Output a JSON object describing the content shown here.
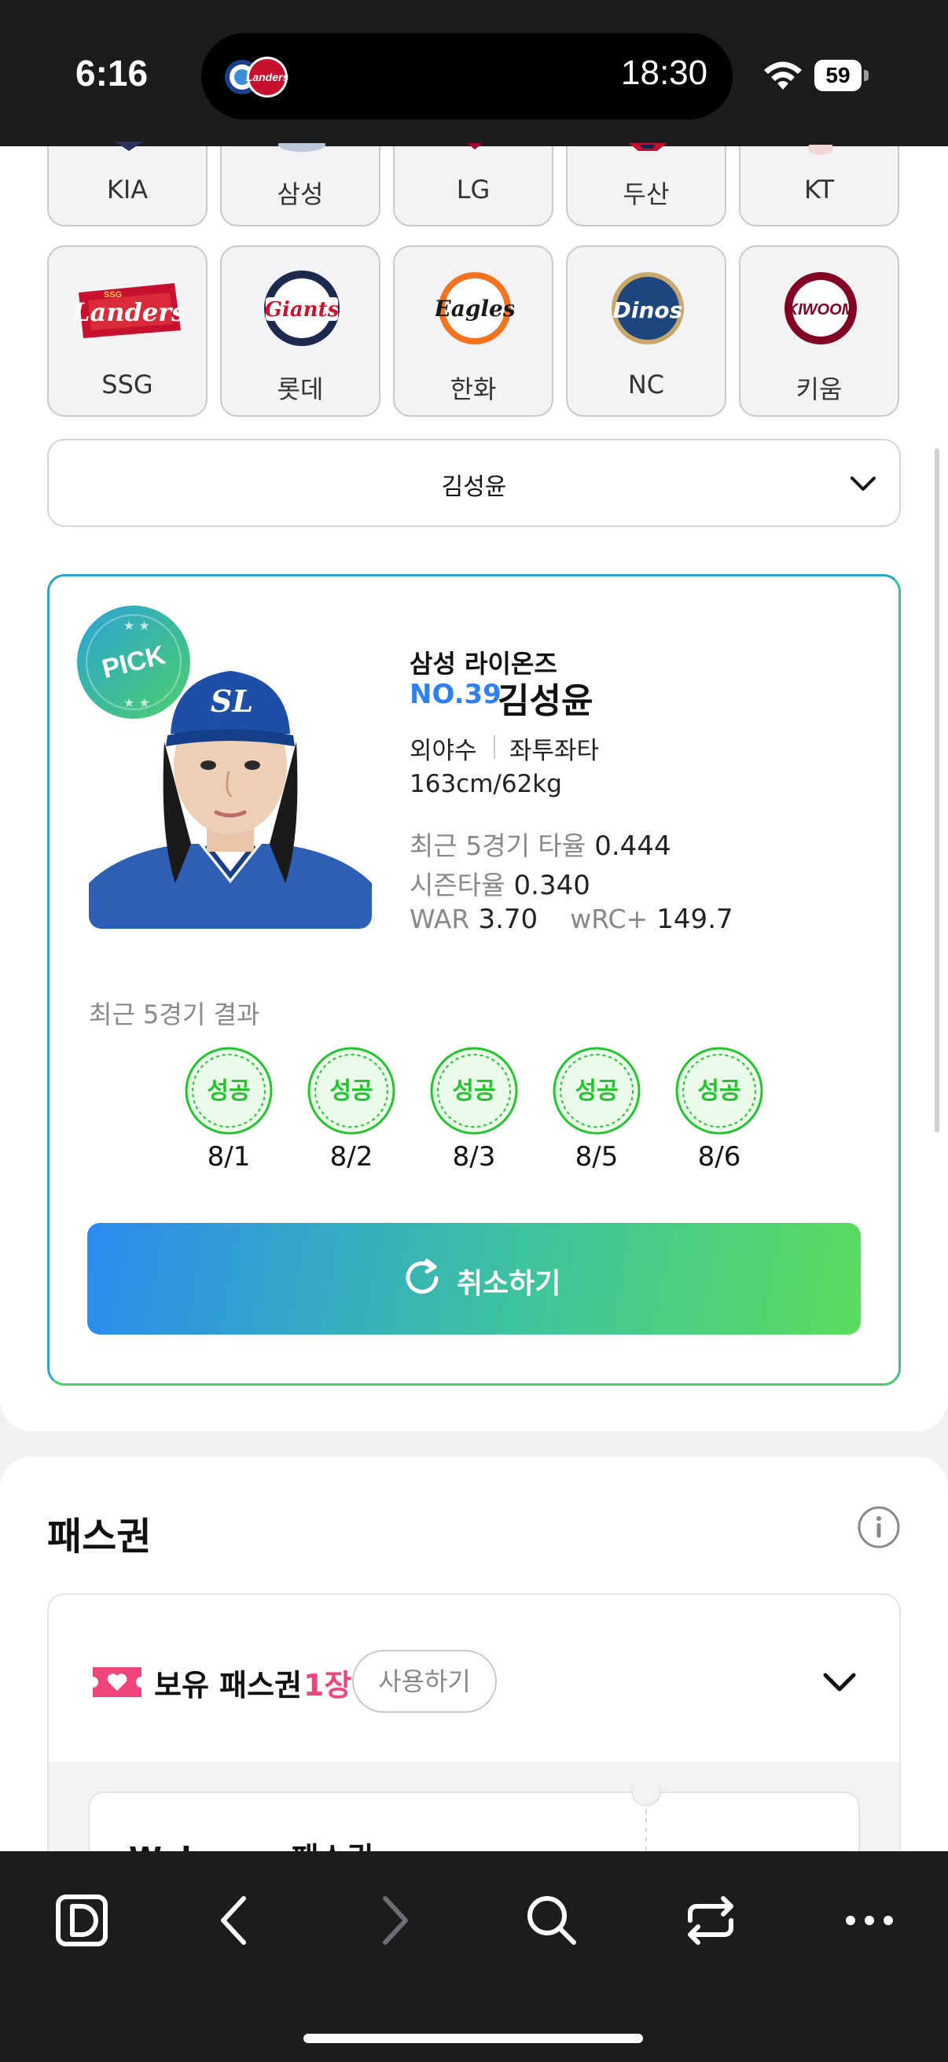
{
  "status_bar": {
    "time": "6:16",
    "island_time": "18:30",
    "battery": "59"
  },
  "teams": [
    {
      "name": "KIA",
      "icon": "kia-tigers-logo"
    },
    {
      "name": "삼성",
      "icon": "samsung-lions-logo"
    },
    {
      "name": "LG",
      "icon": "lg-twins-logo"
    },
    {
      "name": "두산",
      "icon": "doosan-bears-logo"
    },
    {
      "name": "KT",
      "icon": "kt-wiz-logo"
    },
    {
      "name": "SSG",
      "icon": "ssg-landers-logo"
    },
    {
      "name": "롯데",
      "icon": "lotte-giants-logo"
    },
    {
      "name": "한화",
      "icon": "hanwha-eagles-logo"
    },
    {
      "name": "NC",
      "icon": "nc-dinos-logo"
    },
    {
      "name": "키움",
      "icon": "kiwoom-heroes-logo"
    }
  ],
  "logo_text": {
    "ssg": "Landers",
    "lotte": "Giants",
    "hanwha": "Eagles",
    "nc": "Dinos",
    "kiwoom": "KIWOOM",
    "cap": "SL"
  },
  "player_select": {
    "value": "김성윤"
  },
  "player": {
    "badge": "PICK",
    "team": "삼성 라이온즈",
    "number": "NO.39",
    "name": "김성윤",
    "position": "외야수",
    "hand": "좌투좌타",
    "physical": "163cm/62kg",
    "stats": {
      "recent5_avg_label": "최근 5경기 타율",
      "recent5_avg": "0.444",
      "season_avg_label": "시즌타율",
      "season_avg": "0.340",
      "war_label": "WAR",
      "war": "3.70",
      "wrc_label": "wRC+",
      "wrc": "149.7"
    },
    "recent_label": "최근 5경기 결과",
    "results": [
      {
        "result": "성공",
        "date": "8/1"
      },
      {
        "result": "성공",
        "date": "8/2"
      },
      {
        "result": "성공",
        "date": "8/3"
      },
      {
        "result": "성공",
        "date": "8/5"
      },
      {
        "result": "성공",
        "date": "8/6"
      }
    ],
    "cancel_button": "취소하기"
  },
  "pass": {
    "title": "패스권",
    "own_label": "보유 패스권",
    "own_count": "1장",
    "use_button": "사용하기",
    "welcome_title": "Welcome 패스권"
  },
  "colors": {
    "accent_blue": "#2e7ff0",
    "success_green": "#22c52e",
    "pink": "#f0457a",
    "border_gradient_start": "#2ba6c8",
    "border_gradient_end": "#4ccf6a"
  },
  "toolbar_icons": [
    "app-d-icon",
    "back-icon",
    "forward-icon",
    "search-icon",
    "tabs-switch-icon",
    "more-icon"
  ]
}
